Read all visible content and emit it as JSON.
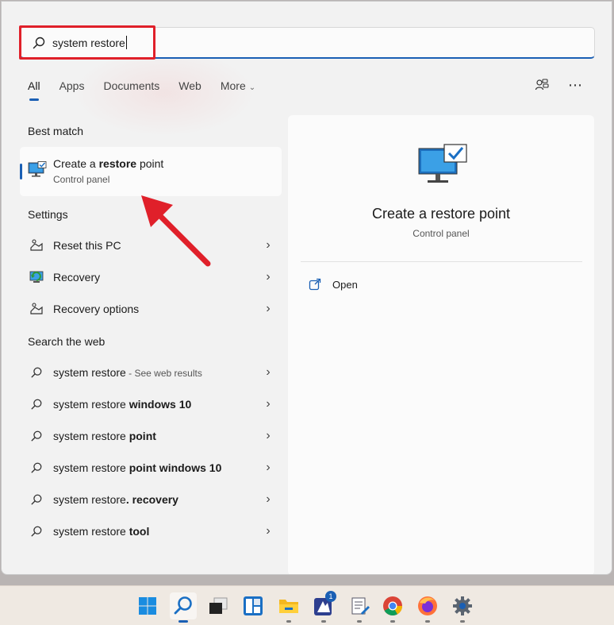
{
  "search": {
    "query": "system restore"
  },
  "tabs": [
    {
      "label": "All",
      "active": true
    },
    {
      "label": "Apps"
    },
    {
      "label": "Documents"
    },
    {
      "label": "Web"
    },
    {
      "label": "More"
    }
  ],
  "sections": {
    "best_match": "Best match",
    "settings": "Settings",
    "search_web": "Search the web"
  },
  "best_match": {
    "title_pre": "Create a ",
    "title_bold": "restore",
    "title_post": " point",
    "subtitle": "Control panel"
  },
  "settings_items": [
    {
      "label": "Reset this PC"
    },
    {
      "label": "Recovery"
    },
    {
      "label": "Recovery options"
    }
  ],
  "web_items": [
    {
      "plain": "system restore",
      "bold": "",
      "muted": " - See web results"
    },
    {
      "plain": "system restore ",
      "bold": "windows 10",
      "muted": ""
    },
    {
      "plain": "system restore ",
      "bold": "point",
      "muted": ""
    },
    {
      "plain": "system restore ",
      "bold": "point windows 10",
      "muted": ""
    },
    {
      "plain": "system restore",
      "bold": ". recovery",
      "muted": ""
    },
    {
      "plain": "system restore ",
      "bold": "tool",
      "muted": ""
    }
  ],
  "preview": {
    "title": "Create a restore point",
    "subtitle": "Control panel",
    "open_label": "Open"
  },
  "taskbar": {
    "notification_badge": "1",
    "icons": [
      "windows-start-icon",
      "search-icon",
      "task-view-icon",
      "widgets-icon",
      "file-explorer-icon",
      "app-badge-icon",
      "notepad-icon",
      "chrome-icon",
      "firefox-icon",
      "settings-icon"
    ]
  },
  "colors": {
    "accent": "#1a5fb4",
    "annotation_red": "#e0202a"
  }
}
